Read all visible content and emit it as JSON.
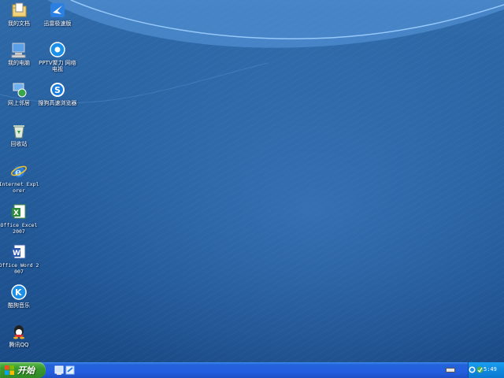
{
  "desktop": {
    "icons": [
      {
        "label": "我的文档",
        "icon": "my-documents-icon"
      },
      {
        "label": "迅雷极速版",
        "icon": "thunder-icon"
      },
      {
        "label": "我的电脑",
        "icon": "my-computer-icon"
      },
      {
        "label": "PPTV聚力 网络电视",
        "icon": "pptv-icon"
      },
      {
        "label": "网上邻居",
        "icon": "network-places-icon"
      },
      {
        "label": "搜狗高速浏览器",
        "icon": "sogou-browser-icon"
      },
      {
        "label": "回收站",
        "icon": "recycle-bin-icon"
      },
      {
        "label": "Internet Explorer",
        "icon": "internet-explorer-icon"
      },
      {
        "label": "Office Excel 2007",
        "icon": "excel-icon"
      },
      {
        "label": "Office Word 2007",
        "icon": "word-icon"
      },
      {
        "label": "酷狗音乐",
        "icon": "kugou-icon"
      },
      {
        "label": "腾讯QQ",
        "icon": "qq-icon"
      }
    ]
  },
  "taskbar": {
    "start_label": "开始",
    "clock": "5:49",
    "colors": {
      "taskbar": "#245ee0",
      "start": "#3a9a2e",
      "tray": "#0f89e0"
    }
  }
}
